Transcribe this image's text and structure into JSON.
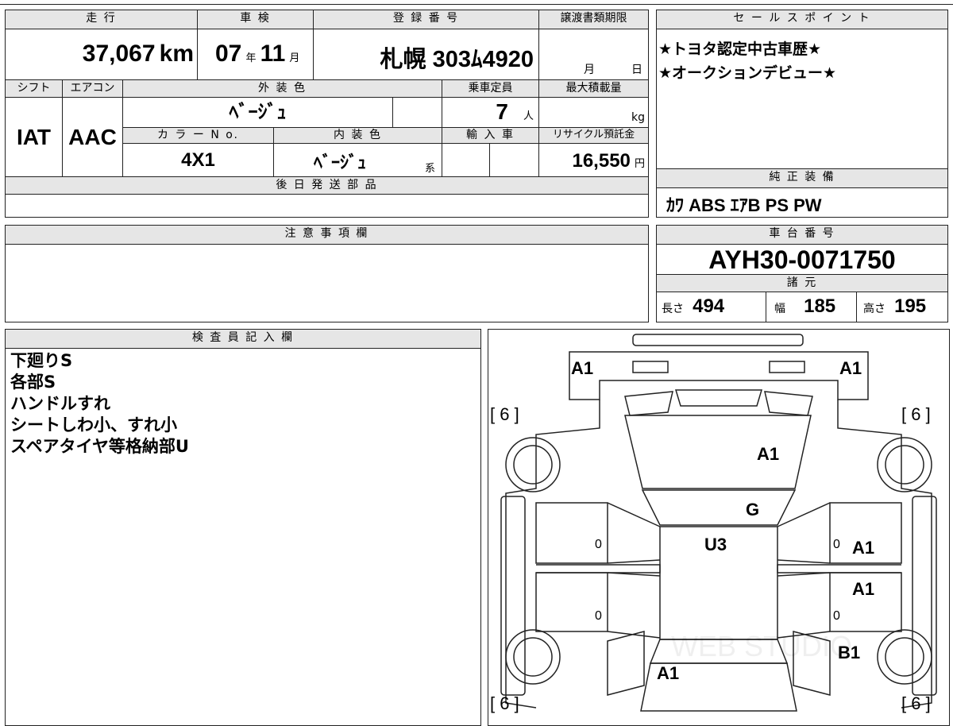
{
  "top": {
    "headers": {
      "mileage": "走 行",
      "inspection": "車 検",
      "registration": "登 録 番 号",
      "transfer_deadline": "譲渡書類期限"
    },
    "mileage": "37,067",
    "mileage_unit": "km",
    "inspection_year": "07",
    "inspection_year_unit": "年",
    "inspection_month": "11",
    "inspection_month_unit": "月",
    "registration_number": "札幌 303ﾑ4920",
    "transfer_month_unit": "月",
    "transfer_day_unit": "日"
  },
  "middle": {
    "headers": {
      "shift": "シフト",
      "aircon": "エアコン",
      "exterior_color": "外 装 色",
      "capacity": "乗車定員",
      "max_load": "最大積載量",
      "color_no": "カ ラ ー N o.",
      "interior_color": "内 装 色",
      "import": "輸 入 車",
      "recycle": "リサイクル預託金"
    },
    "shift": "IAT",
    "aircon": "AAC",
    "exterior_color": "ﾍﾞｰｼﾞｭ",
    "capacity": "7",
    "capacity_unit": "人",
    "max_load_unit": "kg",
    "color_no": "4X1",
    "interior_color": "ﾍﾞｰｼﾞｭ",
    "interior_suffix": "系",
    "recycle_fee": "16,550",
    "recycle_unit": "円"
  },
  "later_parts": {
    "header": "後 日 発 送 部 品",
    "value": ""
  },
  "notes": {
    "header": "注 意 事 項 欄",
    "value": ""
  },
  "sales_points": {
    "header": "セ ー ル ス ポ イ ン ト",
    "lines": [
      "★トヨタ認定中古車歴★",
      "★オークションデビュー★"
    ]
  },
  "equipment": {
    "header": "純 正 装 備",
    "value": "ｶﾜ ABS ｴｱB PS PW"
  },
  "chassis": {
    "header": "車 台 番 号",
    "value": "AYH30-0071750"
  },
  "specs": {
    "header": "諸 元",
    "length_label": "長さ",
    "length": "494",
    "width_label": "幅",
    "width": "185",
    "height_label": "高さ",
    "height": "195"
  },
  "inspector": {
    "header": "検 査 員 記 入 欄",
    "lines": [
      "下廻りS",
      "各部S",
      "ハンドルすれ",
      "シートしわ小、すれ小",
      "スペアタイヤ等格納部U"
    ]
  },
  "diagram": {
    "front_left": "A1",
    "front_right": "A1",
    "hood": "A1",
    "windshield": "G",
    "roof": "U3",
    "right_front_door": "A1",
    "right_rear_door": "A1",
    "right_rear_quarter": "B1",
    "rear": "A1",
    "tire_tl": "[ 6 ]",
    "tire_tr": "[ 6 ]",
    "tire_bl": "[ 6 ]",
    "tire_br": "[ 6 ]",
    "left_front_door_mark": "0",
    "left_rear_door_mark": "0",
    "right_front_door_mark": "0",
    "right_rear_door_mark": "0",
    "watermark": "WEB STUDIO"
  }
}
